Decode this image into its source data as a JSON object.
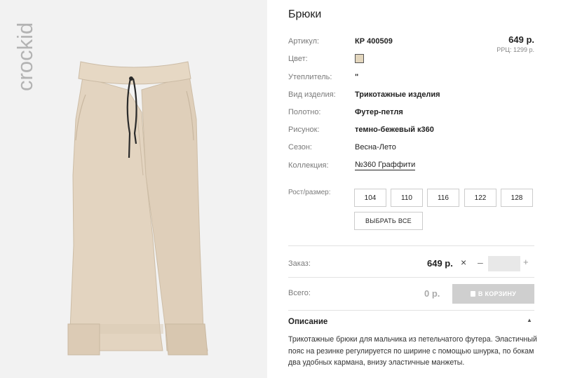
{
  "product": {
    "title": "Брюки",
    "price": "649 р.",
    "rrp": "РРЦ: 1299 р."
  },
  "brand": {
    "logo_text": "crockid"
  },
  "specs": [
    {
      "label": "Артикул:",
      "value": "КР 400509"
    },
    {
      "label": "Цвет:",
      "value": "",
      "color": "#e3d6bd"
    },
    {
      "label": "Утеплитель:",
      "value": "\""
    },
    {
      "label": "Вид изделия:",
      "value": "Трикотажные изделия"
    },
    {
      "label": "Полотно:",
      "value": "Футер-петля"
    },
    {
      "label": "Рисунок:",
      "value": "темно-бежевый к360"
    },
    {
      "label": "Сезон:",
      "value": "Весна-Лето"
    },
    {
      "label": "Коллекция:",
      "value": "№360 Граффити"
    }
  ],
  "sizes": {
    "label": "Рост/размер:",
    "options": [
      "104",
      "110",
      "116",
      "122",
      "128"
    ],
    "select_all": "ВЫБРАТЬ ВСЕ"
  },
  "order": {
    "label": "Заказ:",
    "price": "649 р.",
    "remove_icon": "×",
    "minus": "–",
    "plus": "+",
    "quantity": ""
  },
  "total": {
    "label": "Всего:",
    "value": "0 р.",
    "cart_button": "В КОРЗИНУ"
  },
  "description": {
    "heading": "Описание",
    "caret": "▲",
    "text": "Трикотажные брюки для мальчика из петельчатого футера. Эластичный пояс на резинке регулируется по ширине с помощью шнурка, по бокам два удобных кармана, внизу эластичные манжеты."
  },
  "colors": {
    "product_beige": "#e3d6bd",
    "photo_bg": "#f2f2f2",
    "button_disabled": "#cfcfcf"
  },
  "icons": {
    "remove": "close-icon",
    "cart": "bag-icon",
    "collapse": "chevron-up-icon"
  }
}
